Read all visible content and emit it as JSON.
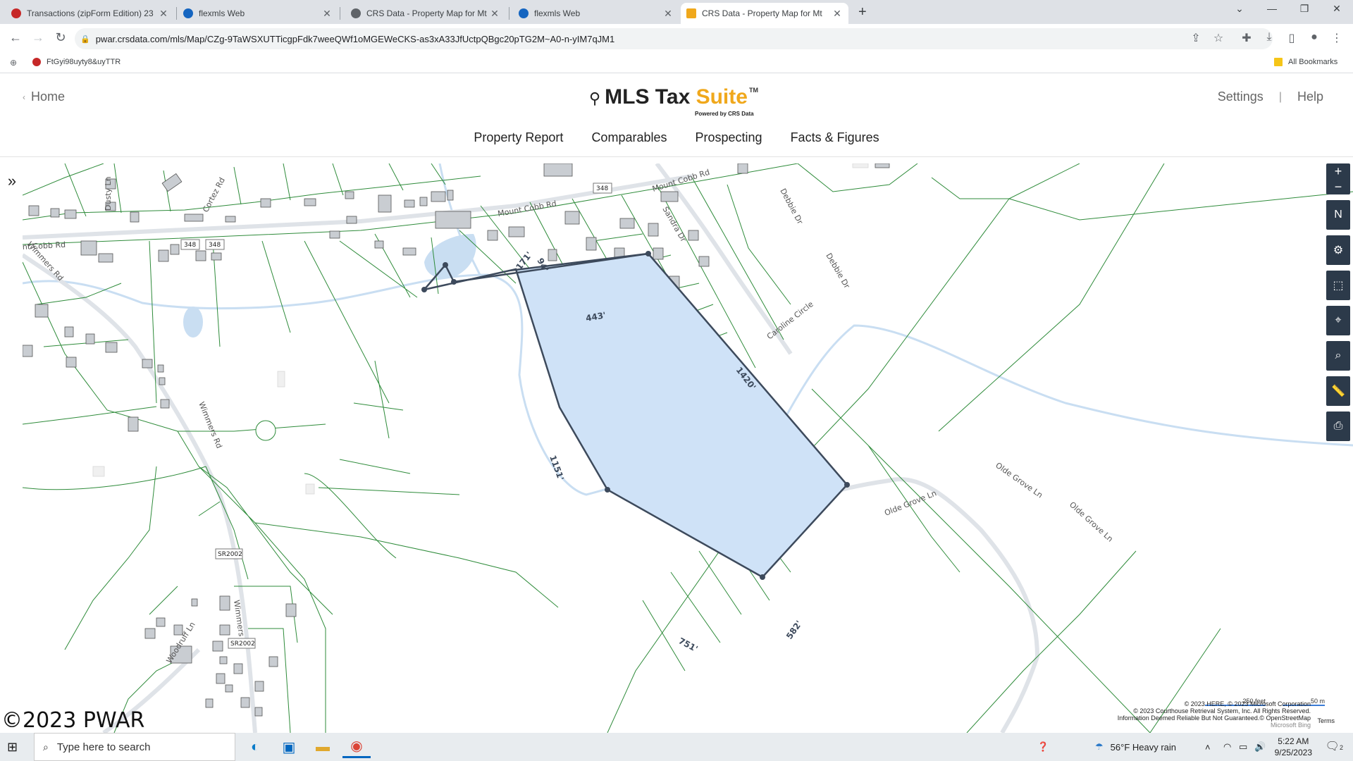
{
  "browser": {
    "tabs": [
      {
        "title": "Transactions (zipForm Edition) 23",
        "favicon_color": "#c62828",
        "active": false
      },
      {
        "title": "flexmls Web",
        "favicon_color": "#1565c0",
        "active": false
      },
      {
        "title": "CRS Data - Property Map for Mt",
        "favicon_color": "#5f6368",
        "active": false
      },
      {
        "title": "flexmls Web",
        "favicon_color": "#1565c0",
        "active": false
      },
      {
        "title": "CRS Data - Property Map for Mt",
        "favicon_color": "#f0a81c",
        "active": true
      }
    ],
    "url": "pwar.crsdata.com/mls/Map/CZg-9TaWSXUTTicgpFdk7weeQWf1oMGEWeCKS-as3xA33JfUctpQBgc20pTG2M~A0-n-yIM7qJM1",
    "bookmarks": [
      {
        "label": "FtGyi98uyty8&uyTTR",
        "icon_color": "#c62828"
      }
    ],
    "all_bookmarks_label": "All Bookmarks"
  },
  "header": {
    "home_label": "Home",
    "brand_main": "MLS Tax ",
    "brand_accent": "Suite",
    "brand_tm": "TM",
    "powered_by": "Powered by CRS Data",
    "settings_label": "Settings",
    "separator": "|",
    "help_label": "Help",
    "nav": [
      "Property Report",
      "Comparables",
      "Prospecting",
      "Facts & Figures"
    ],
    "accent_color": "#f0a81c"
  },
  "map": {
    "road_labels": {
      "mount_cobb_1": "Mount Cobb Rd",
      "mount_cobb_2": "Mount Cobb Rd",
      "mount_cobb_3": "nt Cobb Rd",
      "route_348_a": "348",
      "route_348_b": "348",
      "route_348_c": "348",
      "cortez": "Cortez Rd",
      "dusty": "Dusty Ln",
      "wimmers_1": "Wimmers Rd",
      "wimmers_2": "Wimmers Rd",
      "wimmers_3": "Wimmers Rd",
      "sandra": "Sandra Dr",
      "debbie_1": "Debbie Dr",
      "debbie_2": "Debbie Dr",
      "caroline": "Caroline Circle",
      "sr2002_a": "SR2002",
      "sr2002_b": "SR2002",
      "woodruff": "Woodruff Ln",
      "olde_grove_1": "Olde Grove Ln",
      "olde_grove_2": "Olde Grove Ln",
      "olde_grove_3": "Olde Grove Ln"
    },
    "parcel_dimensions": [
      "171'",
      "94'",
      "443'",
      "1420'",
      "1151'",
      "751'",
      "582'"
    ],
    "parcel_fill": "#cfe2f7",
    "parcel_stroke": "#3d4a5c",
    "parcel_line_color": "#2e8b3a",
    "water_color": "#c9def2",
    "controls": [
      "zoom-in",
      "zoom-out",
      "north-arrow",
      "settings",
      "draw",
      "locate",
      "search",
      "measure",
      "print"
    ],
    "watermark": "©2023 PWAR",
    "attribution_lines": [
      "© 2023 HERE, © 2023 Microsoft Corporation",
      "© 2023 Courthouse Retrieval System, Inc. All Rights Reserved.",
      "Information Deemed Reliable But Not Guaranteed.© OpenStreetMap",
      "Microsoft Bing"
    ],
    "terms_label": "Terms",
    "scale_feet": "250 feet",
    "scale_meters": "50 m"
  },
  "taskbar": {
    "search_placeholder": "Type here to search",
    "weather": "56°F  Heavy rain",
    "time": "5:22 AM",
    "date": "9/25/2023",
    "notification_count": "2"
  }
}
